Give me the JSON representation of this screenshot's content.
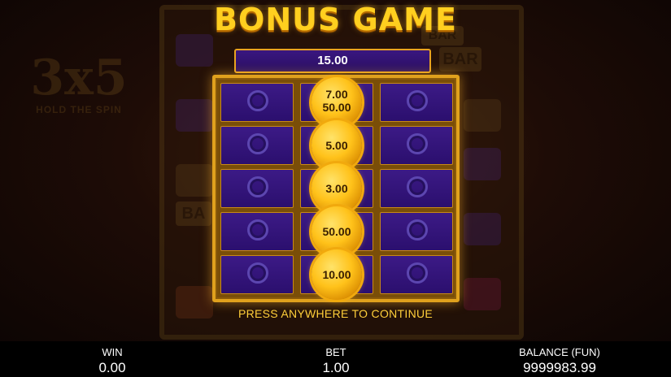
{
  "game": {
    "title": "BONUS GAME",
    "total": "15.00",
    "prompt": "PRESS ANYWHERE TO CONTINUE",
    "logo_main": "3x5",
    "logo_sub": "HOLD THE SPIN",
    "bg_bar_label": "BAR",
    "bg_bar_label_partial": "BA"
  },
  "grid": {
    "columns": 3,
    "rows": 5,
    "coins": [
      {
        "row": 0,
        "col": 1,
        "values": [
          "7.00",
          "50.00"
        ]
      },
      {
        "row": 1,
        "col": 1,
        "values": [
          "5.00"
        ]
      },
      {
        "row": 2,
        "col": 1,
        "values": [
          "3.00"
        ]
      },
      {
        "row": 3,
        "col": 1,
        "values": [
          "50.00"
        ]
      },
      {
        "row": 4,
        "col": 1,
        "values": [
          "10.00"
        ]
      }
    ]
  },
  "footer": {
    "win_label": "WIN",
    "win_value": "0.00",
    "bet_label": "BET",
    "bet_value": "1.00",
    "balance_label": "BALANCE (FUN)",
    "balance_value": "9999983.99"
  },
  "colors": {
    "gold": "#ffcf1f",
    "cell_purple": "#3c1a86",
    "frame_gold": "#e0a11d"
  }
}
